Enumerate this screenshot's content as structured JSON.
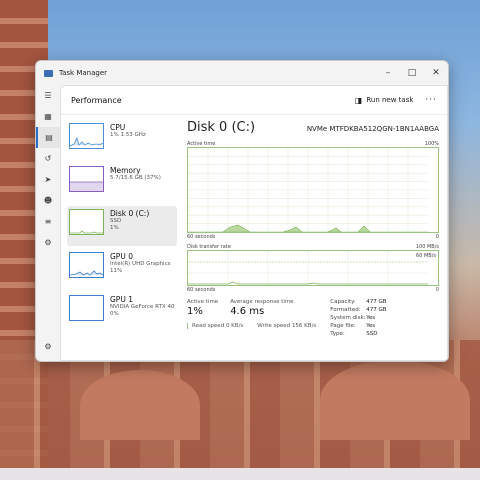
{
  "window": {
    "title": "Task Manager"
  },
  "header": {
    "page_title": "Performance",
    "run_task_label": "Run new task",
    "more_label": "···"
  },
  "devices": [
    {
      "name": "CPU",
      "line1": "1% 1.53 GHz",
      "line2": "",
      "line3": ""
    },
    {
      "name": "Memory",
      "line1": "5.7/15.6 GB (37%)",
      "line2": "",
      "line3": ""
    },
    {
      "name": "Disk 0 (C:)",
      "line1": "SSD",
      "line2": "1%",
      "line3": ""
    },
    {
      "name": "GPU 0",
      "line1": "Intel(R) UHD Graphics",
      "line2": "11%",
      "line3": ""
    },
    {
      "name": "GPU 1",
      "line1": "NVIDIA GeForce RTX 40",
      "line2": "0%",
      "line3": ""
    }
  ],
  "detail": {
    "title": "Disk 0 (C:)",
    "model": "NVMe MTFDKBA512QGN-1BN1AABGA",
    "active_graph": {
      "label": "Active time",
      "max": "100%",
      "time": "60 seconds",
      "min": "0"
    },
    "transfer_graph": {
      "label": "Disk transfer rate",
      "max": "100 MB/s",
      "marker": "60 MB/s",
      "time": "60 seconds",
      "min": "0"
    },
    "stats": {
      "active_time_label": "Active time",
      "active_time": "1%",
      "response_label": "Average response time",
      "response": "4.6 ms",
      "read_label": "Read speed",
      "read": "0 KB/s",
      "write_label": "Write speed",
      "write": "156 KB/s"
    },
    "props": [
      {
        "k": "Capacity:",
        "v": "477 GB"
      },
      {
        "k": "Formatted:",
        "v": "477 GB"
      },
      {
        "k": "System disk:",
        "v": "Yes"
      },
      {
        "k": "Page file:",
        "v": "Yes"
      },
      {
        "k": "Type:",
        "v": "SSD"
      }
    ]
  },
  "colors": {
    "accent": "#2a6fc9",
    "disk": "#7fb35b",
    "cpu": "#4f8fd6",
    "memory": "#8a5fc2",
    "gpu": "#3d7fd0"
  }
}
